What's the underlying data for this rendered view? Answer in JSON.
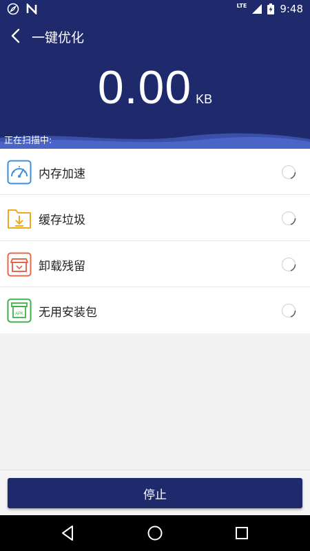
{
  "status_bar": {
    "time": "9:48",
    "network": "LTE",
    "icons": [
      "compass-icon",
      "n-icon",
      "signal-icon",
      "battery-icon"
    ]
  },
  "header": {
    "title": "一键优化",
    "size_value": "0.00",
    "size_unit": "KB",
    "scan_label": "正在扫描中:"
  },
  "items": [
    {
      "label": "内存加速",
      "icon": "speedometer-icon",
      "color": "#3b8de0"
    },
    {
      "label": "缓存垃圾",
      "icon": "folder-download-icon",
      "color": "#f0a91d"
    },
    {
      "label": "卸载残留",
      "icon": "box-icon",
      "color": "#e8674a"
    },
    {
      "label": "无用安装包",
      "icon": "apk-package-icon",
      "color": "#3db14a"
    }
  ],
  "stop_button": {
    "label": "停止"
  },
  "colors": {
    "primary": "#1f2a6d",
    "wave": "#4a64c8"
  }
}
